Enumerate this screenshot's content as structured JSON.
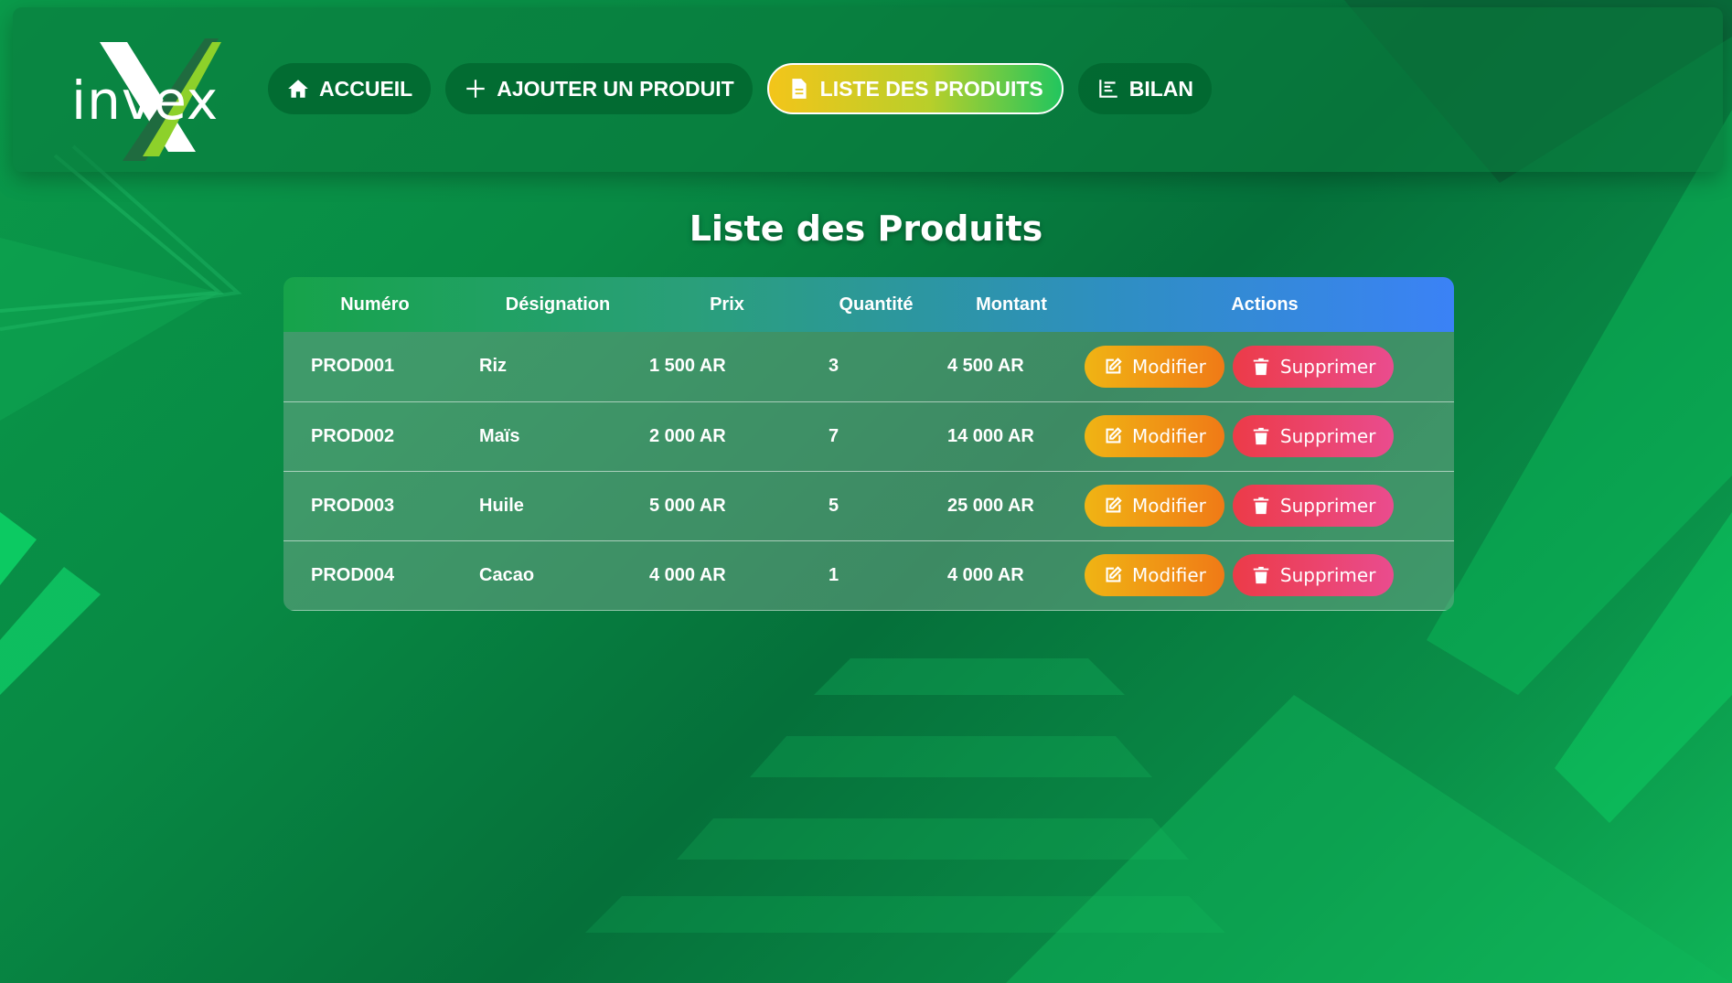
{
  "brand": {
    "logo_text": "invex"
  },
  "nav": {
    "items": [
      {
        "label": "ACCUEIL",
        "icon": "home-icon",
        "active": false
      },
      {
        "label": "AJOUTER UN PRODUIT",
        "icon": "plus-icon",
        "active": false
      },
      {
        "label": "LISTE DES PRODUITS",
        "icon": "file-icon",
        "active": true
      },
      {
        "label": "BILAN",
        "icon": "chart-icon",
        "active": false
      }
    ]
  },
  "page": {
    "title": "Liste des Produits"
  },
  "table": {
    "columns": [
      "Numéro",
      "Désignation",
      "Prix",
      "Quantité",
      "Montant",
      "Actions"
    ],
    "rows": [
      {
        "numero": "PROD001",
        "designation": "Riz",
        "prix": "1 500 AR",
        "quantite": "3",
        "montant": "4 500 AR"
      },
      {
        "numero": "PROD002",
        "designation": "Maïs",
        "prix": "2 000 AR",
        "quantite": "7",
        "montant": "14 000 AR"
      },
      {
        "numero": "PROD003",
        "designation": "Huile",
        "prix": "5 000 AR",
        "quantite": "5",
        "montant": "25 000 AR"
      },
      {
        "numero": "PROD004",
        "designation": "Cacao",
        "prix": "4 000 AR",
        "quantite": "1",
        "montant": "4 000 AR"
      }
    ],
    "actions": {
      "edit_label": "Modifier",
      "delete_label": "Supprimer"
    }
  },
  "colors": {
    "background": "#088a44",
    "active_gradient_start": "#f3c51a",
    "active_gradient_end": "#22c55e",
    "header_gradient_start": "#16a34a",
    "header_gradient_end": "#3b82f6",
    "edit_button": "#f0b414",
    "delete_button": "#ec3b48"
  }
}
